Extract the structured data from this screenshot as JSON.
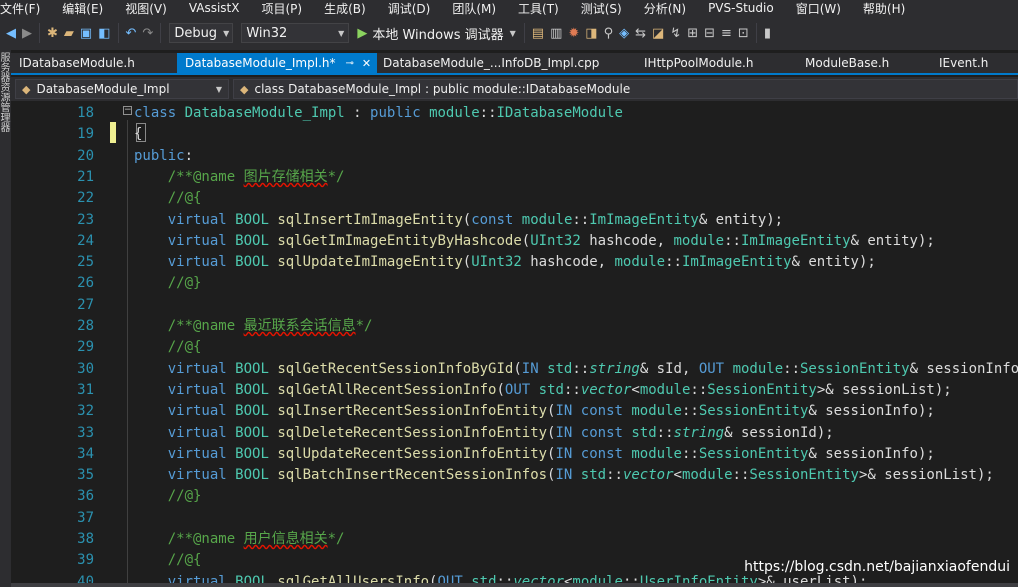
{
  "menu": [
    "文件(F)",
    "编辑(E)",
    "视图(V)",
    "VAssistX",
    "项目(P)",
    "生成(B)",
    "调试(D)",
    "团队(M)",
    "工具(T)",
    "测试(S)",
    "分析(N)",
    "PVS-Studio",
    "窗口(W)",
    "帮助(H)"
  ],
  "toolbar": {
    "config": "Debug",
    "platform": "Win32",
    "run_label": "本地 Windows 调试器"
  },
  "side_panel_label": "服务器资源管理器",
  "tabs": [
    {
      "label": "IDatabaseModule.h",
      "active": false
    },
    {
      "label": "DatabaseModule_Impl.h*",
      "active": true
    },
    {
      "label": "DatabaseModule_...InfoDB_Impl.cpp",
      "active": false
    },
    {
      "label": "IHttpPoolModule.h",
      "active": false
    },
    {
      "label": "ModuleBase.h",
      "active": false
    },
    {
      "label": "IEvent.h",
      "active": false
    }
  ],
  "nav": {
    "scope": "DatabaseModule_Impl",
    "member": "class DatabaseModule_Impl : public module::IDatabaseModule"
  },
  "lines": [
    {
      "n": "18",
      "html": "<span class=\"kw\">class</span> <span class=\"ty\">DatabaseModule_Impl</span> : <span class=\"kw\">public</span> <span class=\"ty\">module</span>::<span class=\"ty\">IDatabaseModule</span>"
    },
    {
      "n": "19",
      "html": "{"
    },
    {
      "n": "20",
      "html": "<span class=\"kw\">public</span>:"
    },
    {
      "n": "21",
      "html": "    <span class=\"cm\">/**@name </span><span class=\"sq\">图片存储相关</span><span class=\"cm\">*/</span>"
    },
    {
      "n": "22",
      "html": "    <span class=\"cm\">//@{</span>"
    },
    {
      "n": "23",
      "html": "    <span class=\"kw\">virtual</span> <span class=\"ty\">BOOL</span> <span class=\"fn\">sqlInsertImImageEntity</span>(<span class=\"kw\">const</span> <span class=\"ty\">module</span>::<span class=\"ty\">ImImageEntity</span>& entity);"
    },
    {
      "n": "24",
      "html": "    <span class=\"kw\">virtual</span> <span class=\"ty\">BOOL</span> <span class=\"fn\">sqlGetImImageEntityByHashcode</span>(<span class=\"ty\">UInt32</span> hashcode, <span class=\"ty\">module</span>::<span class=\"ty\">ImImageEntity</span>& entity);"
    },
    {
      "n": "25",
      "html": "    <span class=\"kw\">virtual</span> <span class=\"ty\">BOOL</span> <span class=\"fn\">sqlUpdateImImageEntity</span>(<span class=\"ty\">UInt32</span> hashcode, <span class=\"ty\">module</span>::<span class=\"ty\">ImImageEntity</span>& entity);"
    },
    {
      "n": "26",
      "html": "    <span class=\"cm\">//@}</span>"
    },
    {
      "n": "27",
      "html": ""
    },
    {
      "n": "28",
      "html": "    <span class=\"cm\">/**@name </span><span class=\"sq\">最近联系会话信息</span><span class=\"cm\">*/</span>"
    },
    {
      "n": "29",
      "html": "    <span class=\"cm\">//@{</span>"
    },
    {
      "n": "30",
      "html": "    <span class=\"kw\">virtual</span> <span class=\"ty\">BOOL</span> <span class=\"fn\">sqlGetRecentSessionInfoByGId</span>(<span class=\"kw\">IN</span> <span class=\"ty\">std</span>::<span class=\"it\">string</span>& sId, <span class=\"kw\">OUT</span> <span class=\"ty\">module</span>::<span class=\"ty\">SessionEntity</span>& sessionInfo);"
    },
    {
      "n": "31",
      "html": "    <span class=\"kw\">virtual</span> <span class=\"ty\">BOOL</span> <span class=\"fn\">sqlGetAllRecentSessionInfo</span>(<span class=\"kw\">OUT</span> <span class=\"ty\">std</span>::<span class=\"it\">vector</span>&lt;<span class=\"ty\">module</span>::<span class=\"ty\">SessionEntity</span>&gt;& sessionList);"
    },
    {
      "n": "32",
      "html": "    <span class=\"kw\">virtual</span> <span class=\"ty\">BOOL</span> <span class=\"fn\">sqlInsertRecentSessionInfoEntity</span>(<span class=\"kw\">IN</span> <span class=\"kw\">const</span> <span class=\"ty\">module</span>::<span class=\"ty\">SessionEntity</span>& sessionInfo);"
    },
    {
      "n": "33",
      "html": "    <span class=\"kw\">virtual</span> <span class=\"ty\">BOOL</span> <span class=\"fn\">sqlDeleteRecentSessionInfoEntity</span>(<span class=\"kw\">IN</span> <span class=\"kw\">const</span> <span class=\"ty\">std</span>::<span class=\"it\">string</span>& sessionId);"
    },
    {
      "n": "34",
      "html": "    <span class=\"kw\">virtual</span> <span class=\"ty\">BOOL</span> <span class=\"fn\">sqlUpdateRecentSessionInfoEntity</span>(<span class=\"kw\">IN</span> <span class=\"kw\">const</span> <span class=\"ty\">module</span>::<span class=\"ty\">SessionEntity</span>& sessionInfo);"
    },
    {
      "n": "35",
      "html": "    <span class=\"kw\">virtual</span> <span class=\"ty\">BOOL</span> <span class=\"fn\">sqlBatchInsertRecentSessionInfos</span>(<span class=\"kw\">IN</span> <span class=\"ty\">std</span>::<span class=\"it\">vector</span>&lt;<span class=\"ty\">module</span>::<span class=\"ty\">SessionEntity</span>&gt;& sessionList);"
    },
    {
      "n": "36",
      "html": "    <span class=\"cm\">//@}</span>"
    },
    {
      "n": "37",
      "html": ""
    },
    {
      "n": "38",
      "html": "    <span class=\"cm\">/**@name </span><span class=\"sq\">用户信息相关</span><span class=\"cm\">*/</span>"
    },
    {
      "n": "39",
      "html": "    <span class=\"cm\">//@{</span>"
    },
    {
      "n": "40",
      "html": "    <span class=\"kw\">virtual</span> <span class=\"ty\">BOOL</span> <span class=\"fn\">sqlGetAllUsersInfo</span>(<span class=\"kw\">OUT</span> <span class=\"ty\">std</span>::<span class=\"it\">vector</span>&lt;<span class=\"ty\">module</span>::<span class=\"ty\">UserInfoEntity</span>&gt;& userList);"
    }
  ],
  "watermark": "https://blog.csdn.net/bajianxiaofendui",
  "colors": {
    "chrome": "#2d2d30",
    "editor_bg": "#1e1e1e",
    "accent": "#007acc",
    "keyword": "#569cd6",
    "type": "#4ec9b0",
    "function": "#dcdcaa",
    "comment": "#57a64a",
    "line_number": "#2b91af"
  }
}
